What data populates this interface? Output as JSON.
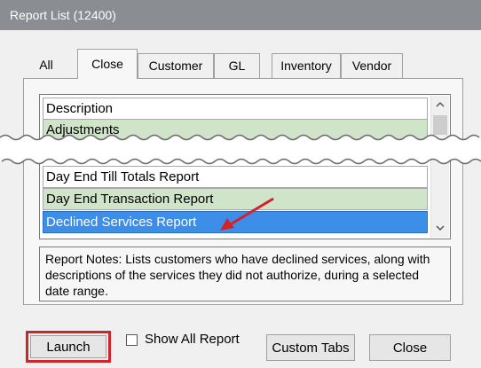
{
  "window": {
    "title": "Report List (12400)"
  },
  "tabs": [
    {
      "label": "All",
      "active": false
    },
    {
      "label": "Close",
      "active": true
    },
    {
      "label": "Customer",
      "active": false
    },
    {
      "label": "GL",
      "active": false
    },
    {
      "label": "Inventory",
      "active": false
    },
    {
      "label": "Vendor",
      "active": false
    }
  ],
  "list": {
    "header": "Description",
    "rows": [
      {
        "label": "Adjustments",
        "style": "green"
      },
      {
        "label": "Day End Till Totals Report",
        "style": "white"
      },
      {
        "label": "Day End Transaction Report",
        "style": "green"
      },
      {
        "label": "Declined Services Report",
        "style": "selected"
      }
    ]
  },
  "notes": {
    "text": "Report Notes:  Lists customers who have declined services, along with descriptions of the services they did not authorize, during a selected date range."
  },
  "buttons": {
    "launch": "Launch",
    "show_all": "Show All Report",
    "custom_tabs": "Custom Tabs",
    "close": "Close"
  },
  "colors": {
    "title_bar": "#8a8d92",
    "row_green": "#cfe4c8",
    "row_selected": "#3d8ee8",
    "highlight": "#d2232a"
  },
  "icons": {
    "scroll_up": "chevron-up-icon",
    "scroll_down": "chevron-down-icon",
    "annotation": "red-arrow-icon"
  }
}
